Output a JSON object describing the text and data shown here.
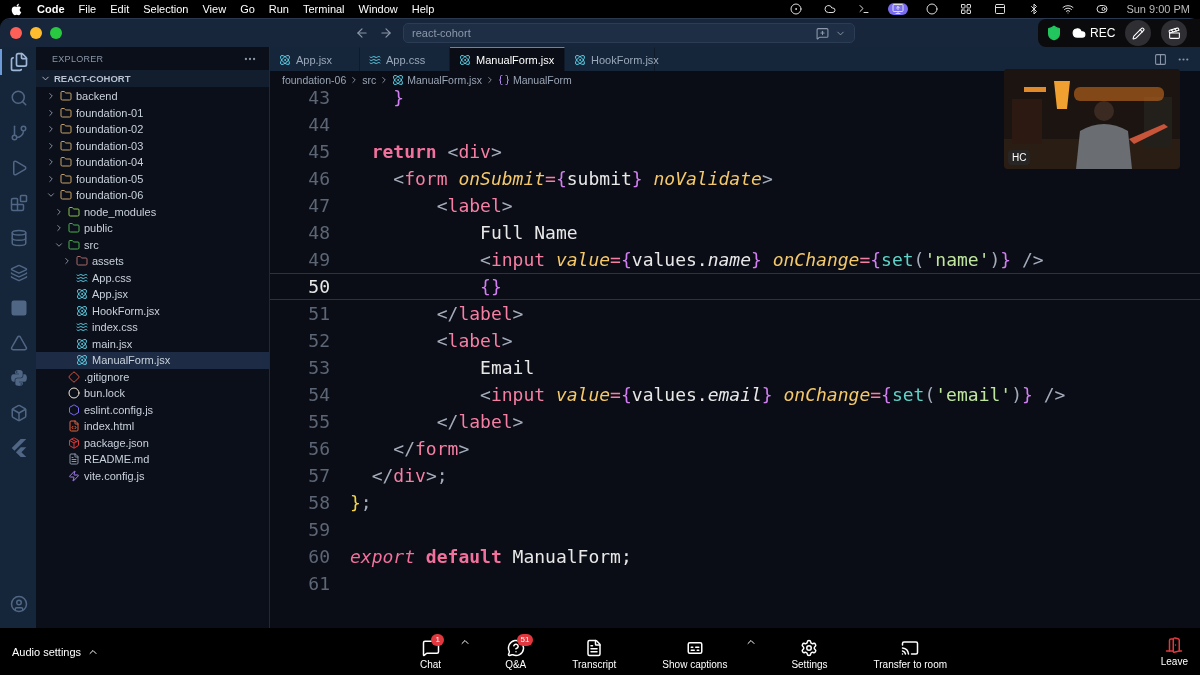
{
  "menubar": {
    "app": "Code",
    "items": [
      "File",
      "Edit",
      "Selection",
      "View",
      "Go",
      "Run",
      "Terminal",
      "Window",
      "Help"
    ],
    "clock": "Sun 9:00 PM"
  },
  "recording": {
    "label": "REC"
  },
  "window": {
    "command_center": "react-cohort"
  },
  "explorer": {
    "title": "EXPLORER",
    "root": "REACT-COHORT",
    "items": [
      {
        "name": "backend",
        "kind": "folder",
        "expanded": false,
        "selected": false
      },
      {
        "name": "foundation-01",
        "kind": "folder",
        "expanded": false,
        "selected": false
      },
      {
        "name": "foundation-02",
        "kind": "folder",
        "expanded": false,
        "selected": false
      },
      {
        "name": "foundation-03",
        "kind": "folder",
        "expanded": false,
        "selected": false
      },
      {
        "name": "foundation-04",
        "kind": "folder",
        "expanded": false,
        "selected": false
      },
      {
        "name": "foundation-05",
        "kind": "folder",
        "expanded": false,
        "selected": false
      },
      {
        "name": "foundation-06",
        "kind": "folder",
        "expanded": true,
        "selected": false,
        "children": [
          {
            "name": "node_modules",
            "kind": "node-folder",
            "expanded": false,
            "selected": false
          },
          {
            "name": "public",
            "kind": "public-folder",
            "expanded": false,
            "selected": false
          },
          {
            "name": "src",
            "kind": "src-folder",
            "expanded": true,
            "selected": false,
            "children": [
              {
                "name": "assets",
                "kind": "assets-folder",
                "expanded": false,
                "selected": false
              },
              {
                "name": "App.css",
                "kind": "css",
                "selected": false
              },
              {
                "name": "App.jsx",
                "kind": "react",
                "selected": false
              },
              {
                "name": "HookForm.jsx",
                "kind": "react",
                "selected": false
              },
              {
                "name": "index.css",
                "kind": "css",
                "selected": false
              },
              {
                "name": "main.jsx",
                "kind": "react",
                "selected": false
              },
              {
                "name": "ManualForm.jsx",
                "kind": "react",
                "selected": true
              }
            ]
          },
          {
            "name": ".gitignore",
            "kind": "git",
            "selected": false
          },
          {
            "name": "bun.lock",
            "kind": "bun",
            "selected": false
          },
          {
            "name": "eslint.config.js",
            "kind": "eslint",
            "selected": false
          },
          {
            "name": "index.html",
            "kind": "html",
            "selected": false
          },
          {
            "name": "package.json",
            "kind": "npm",
            "selected": false
          },
          {
            "name": "README.md",
            "kind": "readme",
            "selected": false
          },
          {
            "name": "vite.config.js",
            "kind": "vite",
            "selected": false
          }
        ]
      }
    ]
  },
  "tabs": [
    {
      "label": "App.jsx",
      "kind": "react",
      "selected": false
    },
    {
      "label": "App.css",
      "kind": "css",
      "selected": false
    },
    {
      "label": "ManualForm.jsx",
      "kind": "react",
      "selected": true
    },
    {
      "label": "HookForm.jsx",
      "kind": "react",
      "selected": false
    }
  ],
  "breadcrumb": [
    {
      "label": "foundation-06",
      "kind": "folder"
    },
    {
      "label": "src",
      "kind": "folder"
    },
    {
      "label": "ManualForm.jsx",
      "kind": "react"
    },
    {
      "label": "ManualForm",
      "kind": "symbol"
    }
  ],
  "code": [
    {
      "number": "43",
      "current": false,
      "tokens": [
        {
          "text": "    }",
          "kind": "brace"
        }
      ]
    },
    {
      "number": "44",
      "current": false
    },
    {
      "number": "45",
      "current": false,
      "tokens": [
        {
          "text": "  return",
          "kind": "keyword"
        },
        {
          "text": " <",
          "kind": "punct"
        },
        {
          "text": "div",
          "kind": "tag"
        },
        {
          "text": ">",
          "kind": "punct"
        }
      ]
    },
    {
      "number": "46",
      "current": false,
      "tokens": [
        {
          "text": "    <",
          "kind": "punct"
        },
        {
          "text": "form",
          "kind": "tag"
        },
        {
          "text": " onSubmit",
          "kind": "attr"
        },
        {
          "text": "=",
          "kind": "op"
        },
        {
          "text": "{",
          "kind": "brace"
        },
        {
          "text": "submit",
          "kind": "plain"
        },
        {
          "text": "}",
          "kind": "brace"
        },
        {
          "text": " noValidate",
          "kind": "attr"
        },
        {
          "text": ">",
          "kind": "punct"
        }
      ]
    },
    {
      "number": "47",
      "current": false,
      "tokens": [
        {
          "text": "        <",
          "kind": "punct"
        },
        {
          "text": "label",
          "kind": "tag"
        },
        {
          "text": ">",
          "kind": "punct"
        }
      ]
    },
    {
      "number": "48",
      "current": false,
      "tokens": [
        {
          "text": "            Full Name",
          "kind": "plain"
        }
      ]
    },
    {
      "number": "49",
      "current": false,
      "tokens": [
        {
          "text": "            <",
          "kind": "punct"
        },
        {
          "text": "input",
          "kind": "tag"
        },
        {
          "text": " value",
          "kind": "attr"
        },
        {
          "text": "=",
          "kind": "op"
        },
        {
          "text": "{",
          "kind": "brace"
        },
        {
          "text": "values.",
          "kind": "plain"
        },
        {
          "text": "name",
          "kind": "prop"
        },
        {
          "text": "}",
          "kind": "brace"
        },
        {
          "text": " onChange",
          "kind": "attr"
        },
        {
          "text": "=",
          "kind": "op"
        },
        {
          "text": "{",
          "kind": "brace"
        },
        {
          "text": "set",
          "kind": "func"
        },
        {
          "text": "(",
          "kind": "punct"
        },
        {
          "text": "'name'",
          "kind": "string"
        },
        {
          "text": ")",
          "kind": "punct"
        },
        {
          "text": "}",
          "kind": "brace"
        },
        {
          "text": " />",
          "kind": "punct"
        }
      ]
    },
    {
      "number": "50",
      "current": true,
      "tokens": [
        {
          "text": "            {}",
          "kind": "brace"
        }
      ]
    },
    {
      "number": "51",
      "current": false,
      "tokens": [
        {
          "text": "        </",
          "kind": "punct"
        },
        {
          "text": "label",
          "kind": "tag"
        },
        {
          "text": ">",
          "kind": "punct"
        }
      ]
    },
    {
      "number": "52",
      "current": false,
      "tokens": [
        {
          "text": "        <",
          "kind": "punct"
        },
        {
          "text": "label",
          "kind": "tag"
        },
        {
          "text": ">",
          "kind": "punct"
        }
      ]
    },
    {
      "number": "53",
      "current": false,
      "tokens": [
        {
          "text": "            Email",
          "kind": "plain"
        }
      ]
    },
    {
      "number": "54",
      "current": false,
      "tokens": [
        {
          "text": "            <",
          "kind": "punct"
        },
        {
          "text": "input",
          "kind": "tag"
        },
        {
          "text": " value",
          "kind": "attr"
        },
        {
          "text": "=",
          "kind": "op"
        },
        {
          "text": "{",
          "kind": "brace"
        },
        {
          "text": "values.",
          "kind": "plain"
        },
        {
          "text": "email",
          "kind": "prop"
        },
        {
          "text": "}",
          "kind": "brace"
        },
        {
          "text": " onChange",
          "kind": "attr"
        },
        {
          "text": "=",
          "kind": "op"
        },
        {
          "text": "{",
          "kind": "brace"
        },
        {
          "text": "set",
          "kind": "func"
        },
        {
          "text": "(",
          "kind": "punct"
        },
        {
          "text": "'email'",
          "kind": "string"
        },
        {
          "text": ")",
          "kind": "punct"
        },
        {
          "text": "}",
          "kind": "brace"
        },
        {
          "text": " />",
          "kind": "punct"
        }
      ]
    },
    {
      "number": "55",
      "current": false,
      "tokens": [
        {
          "text": "        </",
          "kind": "punct"
        },
        {
          "text": "label",
          "kind": "tag"
        },
        {
          "text": ">",
          "kind": "punct"
        }
      ]
    },
    {
      "number": "56",
      "current": false,
      "tokens": [
        {
          "text": "    </",
          "kind": "punct"
        },
        {
          "text": "form",
          "kind": "tag"
        },
        {
          "text": ">",
          "kind": "punct"
        }
      ]
    },
    {
      "number": "57",
      "current": false,
      "tokens": [
        {
          "text": "  </",
          "kind": "punct"
        },
        {
          "text": "div",
          "kind": "tag"
        },
        {
          "text": ">;",
          "kind": "punct"
        }
      ]
    },
    {
      "number": "58",
      "current": false,
      "tokens": [
        {
          "text": "}",
          "kind": "brace2"
        },
        {
          "text": ";",
          "kind": "punct"
        }
      ]
    },
    {
      "number": "59",
      "current": false
    },
    {
      "number": "60",
      "current": false,
      "tokens": [
        {
          "text": "export",
          "kind": "keyword-italic"
        },
        {
          "text": " default",
          "kind": "keyword"
        },
        {
          "text": " ManualForm;",
          "kind": "plain"
        }
      ]
    },
    {
      "number": "61",
      "current": false
    }
  ],
  "video": {
    "kind": "picture",
    "initials": "HC"
  },
  "meeting_bar": {
    "audio": "Audio settings",
    "items": [
      {
        "label": "Chat",
        "kind": "chat",
        "badge": "1",
        "caret": true
      },
      {
        "label": "Q&A",
        "kind": "qa",
        "badge": "51",
        "caret": false
      },
      {
        "label": "Transcript",
        "kind": "transcript",
        "caret": false
      },
      {
        "label": "Show captions",
        "kind": "captions",
        "caret": true
      },
      {
        "label": "Settings",
        "kind": "settings",
        "caret": false
      },
      {
        "label": "Transfer to room",
        "kind": "transfer",
        "caret": false
      }
    ],
    "leave": {
      "label": "Leave"
    }
  }
}
